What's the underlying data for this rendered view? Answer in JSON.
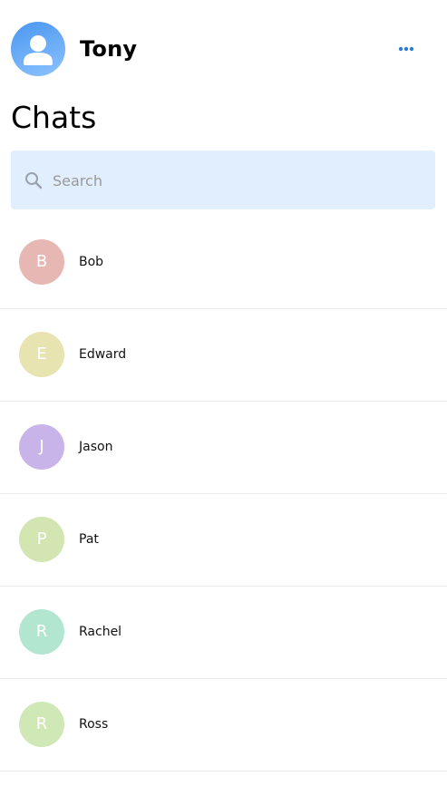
{
  "user": {
    "name": "Tony",
    "avatar_icon": "user-silhouette-icon",
    "avatar_color_top": "#4a97f0",
    "avatar_color_bottom": "#8cc2ff"
  },
  "header": {
    "more_icon": "more-horizontal-icon",
    "more_color": "#2f7fd0"
  },
  "page": {
    "title": "Chats"
  },
  "search": {
    "placeholder": "Search",
    "value": "",
    "icon": "search-icon",
    "background": "#e1eefd"
  },
  "chats": [
    {
      "initial": "B",
      "name": "Bob",
      "color": "#e6b7b3"
    },
    {
      "initial": "E",
      "name": "Edward",
      "color": "#e8e4b1"
    },
    {
      "initial": "J",
      "name": "Jason",
      "color": "#c8b4e8"
    },
    {
      "initial": "P",
      "name": "Pat",
      "color": "#d3e6b2"
    },
    {
      "initial": "R",
      "name": "Rachel",
      "color": "#b3e6d1"
    },
    {
      "initial": "R",
      "name": "Ross",
      "color": "#cfe8b5"
    }
  ]
}
